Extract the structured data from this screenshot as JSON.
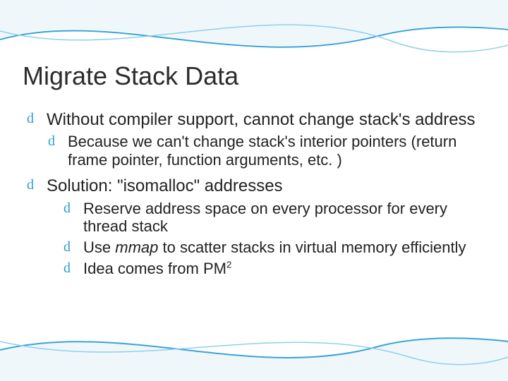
{
  "title": "Migrate Stack Data",
  "bullets": {
    "b1": "Without compiler support, cannot change stack's address",
    "b1_1": "Because we can't change stack's interior pointers (return frame pointer, function arguments, etc. )",
    "b2": "Solution: \"isomalloc\" addresses",
    "b2_1": "Reserve address space on every processor for every thread stack",
    "b2_2_pre": "Use ",
    "b2_2_em": "mmap",
    "b2_2_post": " to scatter stacks in virtual memory efficiently",
    "b2_3_pre": "Idea comes from PM",
    "b2_3_sup": "2"
  },
  "bullet_glyph": "d"
}
